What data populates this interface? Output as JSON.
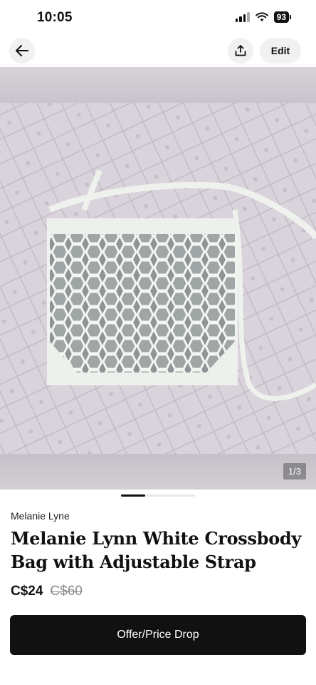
{
  "status": {
    "time": "10:05",
    "battery": "93"
  },
  "nav": {
    "edit_label": "Edit"
  },
  "gallery": {
    "counter": "1/3",
    "active_index": 1,
    "total": 3
  },
  "listing": {
    "brand": "Melanie Lyne",
    "title": "Melanie Lynn White Crossbody Bag with Adjustable Strap",
    "price": "C$24",
    "original_price": "C$60"
  },
  "actions": {
    "offer_label": "Offer/Price Drop"
  },
  "colors": {
    "primary_button": "#111111",
    "background": "#ffffff"
  }
}
